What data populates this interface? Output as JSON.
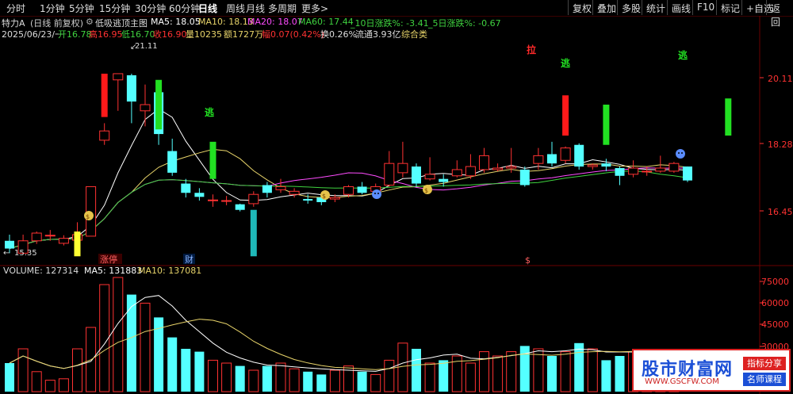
{
  "toolbar": {
    "tabs": [
      "分时",
      "1分钟",
      "5分钟",
      "15分钟",
      "30分钟",
      "60分钟",
      "日线",
      "周线",
      "月线",
      "多周期",
      "更多>"
    ],
    "active_tab": "日线",
    "right_buttons": [
      "复权",
      "叠加",
      "多股",
      "统计",
      "画线",
      "F10",
      "标记",
      "+自选",
      "返回"
    ]
  },
  "header": {
    "stock": "特力A",
    "adjust": "(日线 前复权)",
    "indicator": "低吸逃顶主图",
    "ma5": "MA5: 18.05",
    "ma10": "MA10: 18.13",
    "ma20": "MA20: 18.07",
    "ma60": "MA60: 17.44",
    "chg10": "_10日涨跌%: -3.41",
    "chg5": "_5日涨跌%: -0.67",
    "date": "2025/06/23/一",
    "open": "开16.78",
    "high": "高16.95",
    "low": "低16.70",
    "close": "收16.90",
    "vol": "量10235",
    "amount": "额1727万",
    "amp": "幅0.07(0.42%)",
    "turnover": "换0.26%",
    "float": "流通3.93亿",
    "sector": "综合类"
  },
  "price_axis": {
    "labels": [
      "20.11",
      "18.28",
      "16.45"
    ]
  },
  "annotations": {
    "high_mark": "21.11",
    "low_mark": "15.35",
    "escape1": "逃",
    "escape2": "逃",
    "escape3": "逃",
    "pull": "拉",
    "limit_tag": "涨停",
    "fin_tag": "财",
    "s_tag": "$"
  },
  "volume": {
    "header_volume": "VOLUME: 127314",
    "header_ma5": "MA5: 131883",
    "header_ma10": "MA10: 137081",
    "axis": [
      "75000",
      "60000",
      "45000",
      "30000"
    ]
  },
  "watermark": {
    "title": "股市财富网",
    "url": "WWW.GSCFW.COM",
    "tag1": "指标分享",
    "tag2": "名师课程"
  },
  "colors": {
    "up": "#ff3232",
    "down": "#54ffff",
    "ma5": "#ffffff",
    "ma10": "#e8d46a",
    "ma20": "#ff4cff",
    "ma60": "#3fd23f",
    "buy_signal": "#ff1a1a",
    "sell_signal": "#22e022"
  },
  "chart_data": {
    "type": "candlestick",
    "ylim": [
      15.0,
      22.3
    ],
    "candles": [
      {
        "o": 15.8,
        "c": 15.55,
        "h": 16.0,
        "l": 15.4
      },
      {
        "o": 15.4,
        "c": 15.8,
        "h": 16.0,
        "l": 15.35
      },
      {
        "o": 15.8,
        "c": 16.05,
        "h": 16.1,
        "l": 15.7
      },
      {
        "o": 15.98,
        "c": 15.98,
        "h": 16.15,
        "l": 15.8
      },
      {
        "o": 15.72,
        "c": 15.88,
        "h": 15.98,
        "l": 15.65
      },
      {
        "o": 15.82,
        "c": 16.0,
        "h": 16.4,
        "l": 15.5
      },
      {
        "o": 15.95,
        "c": 17.55,
        "h": 17.55,
        "l": 15.95
      },
      {
        "o": 19.05,
        "c": 19.35,
        "h": 19.6,
        "l": 18.9
      },
      {
        "o": 21.0,
        "c": 21.2,
        "h": 21.2,
        "l": 20.0
      },
      {
        "o": 21.15,
        "c": 20.3,
        "h": 21.2,
        "l": 19.6
      },
      {
        "o": 20.0,
        "c": 20.2,
        "h": 20.85,
        "l": 19.5
      },
      {
        "o": 20.6,
        "c": 19.25,
        "h": 20.7,
        "l": 18.9
      },
      {
        "o": 18.7,
        "c": 18.0,
        "h": 19.1,
        "l": 17.9
      },
      {
        "o": 17.65,
        "c": 17.35,
        "h": 17.8,
        "l": 17.2
      },
      {
        "o": 17.35,
        "c": 17.22,
        "h": 17.5,
        "l": 17.1
      },
      {
        "o": 17.12,
        "c": 17.12,
        "h": 17.3,
        "l": 16.9
      },
      {
        "o": 17.1,
        "c": 17.1,
        "h": 17.25,
        "l": 16.95
      },
      {
        "o": 16.98,
        "c": 16.8,
        "h": 17.0,
        "l": 16.75
      },
      {
        "o": 17.0,
        "c": 17.3,
        "h": 17.4,
        "l": 16.9
      },
      {
        "o": 17.6,
        "c": 17.35,
        "h": 17.7,
        "l": 17.2
      },
      {
        "o": 17.45,
        "c": 17.55,
        "h": 17.8,
        "l": 17.35
      },
      {
        "o": 17.3,
        "c": 17.4,
        "h": 17.5,
        "l": 17.2
      },
      {
        "o": 17.15,
        "c": 17.1,
        "h": 17.3,
        "l": 17.0
      },
      {
        "o": 17.2,
        "c": 17.05,
        "h": 17.3,
        "l": 16.95
      },
      {
        "o": 17.15,
        "c": 17.2,
        "h": 17.3,
        "l": 17.05
      },
      {
        "o": 17.3,
        "c": 17.55,
        "h": 17.6,
        "l": 17.2
      },
      {
        "o": 17.55,
        "c": 17.35,
        "h": 17.7,
        "l": 17.3
      },
      {
        "o": 17.4,
        "c": 17.55,
        "h": 17.65,
        "l": 17.35
      },
      {
        "o": 17.6,
        "c": 18.3,
        "h": 18.7,
        "l": 17.55
      },
      {
        "o": 18.0,
        "c": 18.3,
        "h": 19.0,
        "l": 17.85
      },
      {
        "o": 18.2,
        "c": 17.65,
        "h": 18.3,
        "l": 17.55
      },
      {
        "o": 17.8,
        "c": 17.95,
        "h": 18.5,
        "l": 17.75
      },
      {
        "o": 17.8,
        "c": 17.7,
        "h": 17.95,
        "l": 17.55
      },
      {
        "o": 17.9,
        "c": 18.1,
        "h": 18.4,
        "l": 17.85
      },
      {
        "o": 17.9,
        "c": 18.2,
        "h": 18.6,
        "l": 17.8
      },
      {
        "o": 18.1,
        "c": 18.55,
        "h": 18.8,
        "l": 18.0
      },
      {
        "o": 18.1,
        "c": 18.15,
        "h": 18.3,
        "l": 18.05
      },
      {
        "o": 18.15,
        "c": 18.2,
        "h": 18.8,
        "l": 18.0
      },
      {
        "o": 18.1,
        "c": 17.6,
        "h": 18.2,
        "l": 17.55
      },
      {
        "o": 18.3,
        "c": 18.55,
        "h": 18.8,
        "l": 18.1
      },
      {
        "o": 18.6,
        "c": 18.3,
        "h": 19.0,
        "l": 18.2
      },
      {
        "o": 18.4,
        "c": 18.8,
        "h": 18.85,
        "l": 18.3
      },
      {
        "o": 18.9,
        "c": 18.2,
        "h": 18.95,
        "l": 18.1
      },
      {
        "o": 18.2,
        "c": 18.25,
        "h": 18.3,
        "l": 18.1
      },
      {
        "o": 18.3,
        "c": 18.2,
        "h": 18.45,
        "l": 18.05
      },
      {
        "o": 18.15,
        "c": 17.9,
        "h": 18.2,
        "l": 17.6
      },
      {
        "o": 17.95,
        "c": 18.15,
        "h": 18.4,
        "l": 17.85
      },
      {
        "o": 18.05,
        "c": 18.05,
        "h": 18.2,
        "l": 17.9
      },
      {
        "o": 18.05,
        "c": 18.15,
        "h": 18.55,
        "l": 18.0
      },
      {
        "o": 18.05,
        "c": 18.3,
        "h": 18.35,
        "l": 18.0
      },
      {
        "o": 18.2,
        "c": 17.75,
        "h": 18.2,
        "l": 17.7
      }
    ],
    "volumes": [
      20000,
      30000,
      14000,
      8000,
      9000,
      30000,
      45000,
      75000,
      80000,
      68000,
      62000,
      52000,
      38000,
      30000,
      28000,
      22000,
      20000,
      18000,
      15000,
      18000,
      20000,
      16000,
      14000,
      12000,
      15000,
      18000,
      14000,
      12000,
      22000,
      34000,
      30000,
      20000,
      22000,
      25000,
      20000,
      28000,
      25000,
      28000,
      32000,
      30000,
      25000,
      28000,
      34000,
      30000,
      22000,
      25000,
      28000,
      20000,
      26000,
      22000,
      18000
    ],
    "signal_bars": [
      {
        "i": 5,
        "top": 16.1,
        "bottom": 15.3,
        "color": "yellow"
      },
      {
        "i": 7,
        "top": 21.2,
        "bottom": 19.8,
        "color": "red"
      },
      {
        "i": 11,
        "top": 21.0,
        "bottom": 19.4,
        "color": "green"
      },
      {
        "i": 15,
        "top": 19.0,
        "bottom": 17.8,
        "color": "green"
      },
      {
        "i": 18,
        "top": 16.8,
        "bottom": 15.3,
        "color": "cyan"
      },
      {
        "i": 41,
        "top": 20.5,
        "bottom": 19.2,
        "color": "red"
      },
      {
        "i": 44,
        "top": 20.2,
        "bottom": 18.9,
        "color": "green"
      },
      {
        "i": 53,
        "top": 20.4,
        "bottom": 19.2,
        "color": "green"
      }
    ]
  }
}
